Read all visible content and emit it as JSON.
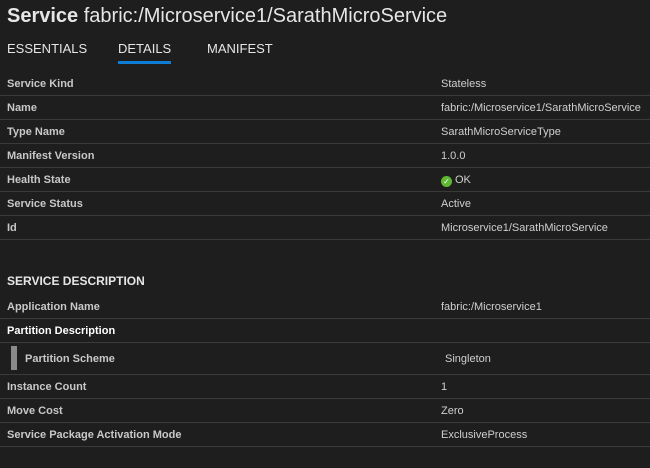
{
  "header": {
    "kind": "Service",
    "name": "fabric:/Microservice1/SarathMicroService"
  },
  "tabs": [
    {
      "label": "ESSENTIALS",
      "active": false
    },
    {
      "label": "DETAILS",
      "active": true
    },
    {
      "label": "MANIFEST",
      "active": false
    }
  ],
  "details": [
    {
      "key": "Service Kind",
      "value": "Stateless"
    },
    {
      "key": "Name",
      "value": "fabric:/Microservice1/SarathMicroService"
    },
    {
      "key": "Type Name",
      "value": "SarathMicroServiceType"
    },
    {
      "key": "Manifest Version",
      "value": "1.0.0"
    },
    {
      "key": "Health State",
      "value": "OK",
      "icon": "ok-check-icon"
    },
    {
      "key": "Service Status",
      "value": "Active"
    },
    {
      "key": "Id",
      "value": "Microservice1/SarathMicroService"
    }
  ],
  "service_description": {
    "title": "SERVICE DESCRIPTION",
    "application_name": {
      "key": "Application Name",
      "value": "fabric:/Microservice1"
    },
    "partition_description": {
      "label": "Partition Description",
      "scheme": {
        "key": "Partition Scheme",
        "value": "Singleton"
      }
    },
    "rows": [
      {
        "key": "Instance Count",
        "value": "1"
      },
      {
        "key": "Move Cost",
        "value": "Zero"
      },
      {
        "key": "Service Package Activation Mode",
        "value": "ExclusiveProcess"
      }
    ]
  },
  "colors": {
    "background": "#1e1e1e",
    "accent": "#0e7dd3",
    "ok": "#5fb832"
  }
}
